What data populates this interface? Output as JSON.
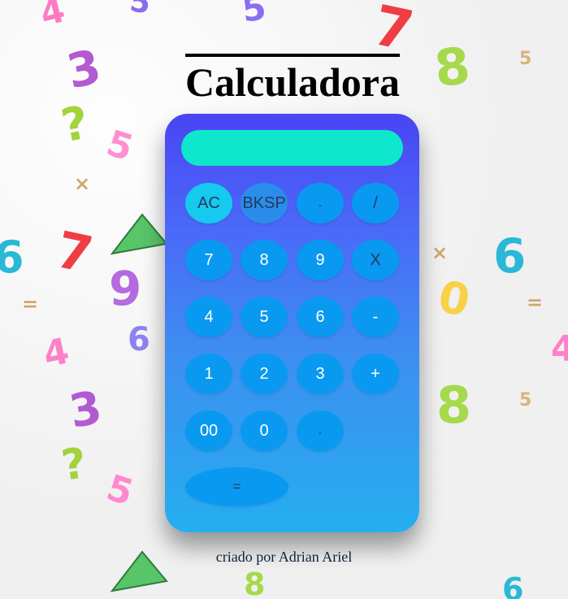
{
  "page": {
    "title": "Calculadora",
    "footer": "criado por Adrian Ariel"
  },
  "calculator": {
    "display_value": "",
    "display_placeholder": "",
    "buttons": {
      "ac": "AC",
      "bksp": "BKSP",
      "dot_top": ".",
      "divide": "/",
      "seven": "7",
      "eight": "8",
      "nine": "9",
      "multiply": "X",
      "four": "4",
      "five": "5",
      "six": "6",
      "minus": "-",
      "one": "1",
      "two": "2",
      "three": "3",
      "plus": "+",
      "double_zero": "00",
      "zero": "0",
      "dot_bottom": ".",
      "equals": "="
    }
  },
  "background": {
    "glyphs": [
      {
        "text": "4",
        "color": "#ff7ac4"
      },
      {
        "text": "5",
        "color": "#8b6cf0"
      },
      {
        "text": "5",
        "color": "#8b6cf0"
      },
      {
        "text": "8",
        "color": "#a6d94c"
      },
      {
        "text": "5",
        "color": "#d8b37a"
      },
      {
        "text": "7",
        "color": "#ef3d43"
      },
      {
        "text": "3",
        "color": "#b15ad2"
      },
      {
        "text": "?",
        "color": "#a1d33c"
      },
      {
        "text": "5",
        "color": "#ff8fd1"
      },
      {
        "text": "×",
        "color": "#cfa86d"
      },
      {
        "text": "6",
        "color": "#29b8d5"
      },
      {
        "text": "9",
        "color": "#b46ae0"
      },
      {
        "text": "=",
        "color": "#cfa86d"
      },
      {
        "text": "4",
        "color": "#ff80c8"
      },
      {
        "text": "6",
        "color": "#8e82f2"
      },
      {
        "text": "3",
        "color": "#b15ad2"
      },
      {
        "text": "?",
        "color": "#a1d33c"
      },
      {
        "text": "5",
        "color": "#ff88cf"
      },
      {
        "text": "8",
        "color": "#a6d94c"
      },
      {
        "text": "5",
        "color": "#d8b37a"
      },
      {
        "text": "7",
        "color": "#ef3d43"
      },
      {
        "text": "6",
        "color": "#29b8d5"
      },
      {
        "text": "0",
        "color": "#f8d146"
      },
      {
        "text": "=",
        "color": "#cfa86d"
      },
      {
        "text": "4",
        "color": "#ff80c8"
      },
      {
        "text": "8",
        "color": "#a6d94c"
      },
      {
        "text": "×",
        "color": "#cfa86d"
      },
      {
        "text": "6",
        "color": "#29b8d5"
      }
    ]
  }
}
